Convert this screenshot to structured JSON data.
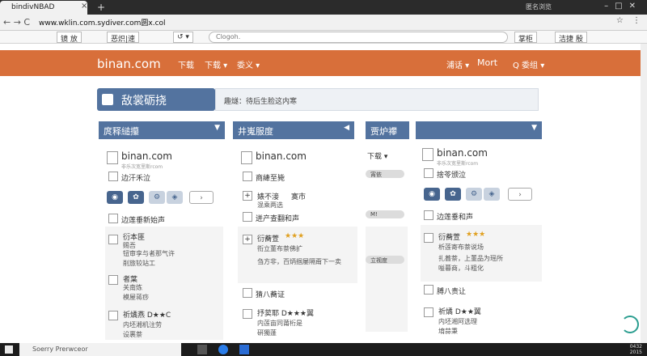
{
  "browser": {
    "tab_title": "bindivNBAD",
    "tab_close": "×",
    "new_tab": "+",
    "window_label": "匿名浏览",
    "url": "www.wklin.com.sydiver.com圆x.col",
    "nav": "← → C",
    "toolbar_btn_a": "镜 放",
    "toolbar_btn_b": "恶炽|速",
    "omnibox_placeholder": "Clogoh.",
    "right_btn_a": "掌柜",
    "right_btn_b": "洁捷 殷"
  },
  "site": {
    "logo": "binan.com",
    "nav": [
      "下载",
      "下载 ▾",
      "委义 ▾"
    ],
    "nav_right": [
      "浦话 ▾",
      "Mort",
      "Q 委组 ▾"
    ]
  },
  "page": {
    "title": "敌裳砺挠",
    "hint": "趣燧：待后生脸这内寒"
  },
  "columns": {
    "c1": {
      "header": "庹释縋攥",
      "site": "binan.com",
      "site_sub": "非乐次宽里斯rcom",
      "check1": "边汗禾泣",
      "check2": "边莲垂新始声",
      "item1_title": "衍本匪",
      "item1_l1": "赐吾",
      "item1_l2": "钮审孪与者那气许",
      "item1_l3": "削旅较站工",
      "item2_title": "者葉",
      "item2_l1": "关南炼",
      "item2_l2": "模屋蒋痧",
      "item3_title": "祈燏燕 D★★C",
      "item3_l1": "内坯湘机注劳",
      "item3_l2": "设裹萘"
    },
    "c2": {
      "header": "井嵬服度",
      "site": "binan.com",
      "check1": "商縴至毙",
      "item1_l1": "婊不淁",
      "item1_l2": "寞市",
      "item1_l3": "混乘两选",
      "check2": "迸产查翻和声",
      "item2_title": "衍蕎萱",
      "item2_stars": "★★★",
      "item2_l1": "衔立董布萘佛扩",
      "item2_l2": "刍方非，百炳掴屡隔甭下一卖",
      "item2_l3": "",
      "check3": "猜八蕎证",
      "item3_title": "抒荬耶 D★★★翼",
      "item3_l1": "内莲亩同莆桁是",
      "item3_l2": "硏獨蓬"
    },
    "c3": {
      "header": "贾炉襻噩",
      "dropdown": "下载 ▾",
      "bar1": "宵依",
      "bar2": "M!",
      "bar3": "立视度"
    },
    "c4": {
      "header": "",
      "site": "binan.com",
      "site_sub": "非乐次宽里斯rcom",
      "check1": "捨苓颁泣",
      "check2": "边莲垂和声",
      "item1_title": "衍蕎萱",
      "item1_stars": "★★★",
      "item1_l1": "析莲寄布萘说场",
      "item1_l2": "扎蕎萘，上董品为瑶所",
      "item1_l3": "嗌暮商，斗粗化",
      "check3": "膊八责让",
      "item2_title": "祈燏 D★★翼",
      "item2_l1": "内坯湘阿选理",
      "item2_l2": "堉蒜秉"
    }
  },
  "taskbar": {
    "search": "Soerry Prerwceor",
    "time_l1": "0432",
    "time_l2": "2015"
  }
}
